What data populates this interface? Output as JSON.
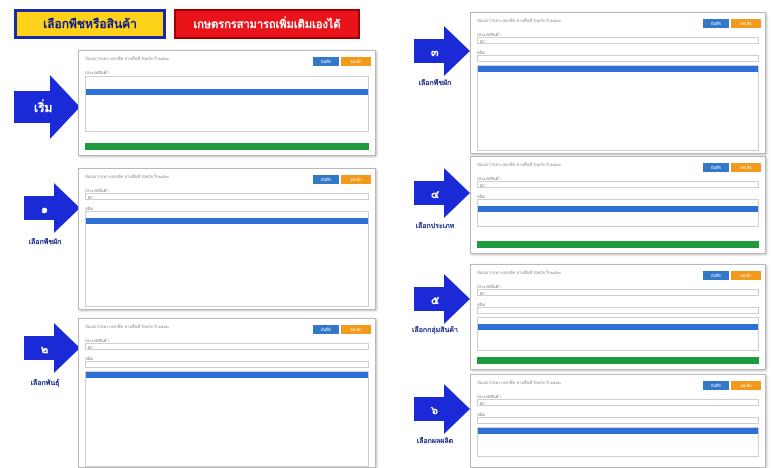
{
  "header": {
    "title_button": "เลือกพืชหรือสินค้า",
    "farmer_button": "เกษตรกรสามารถเพิ่มเติมเองได้"
  },
  "steps": [
    {
      "icon": "arrow-right-icon",
      "number": "เริ่ม",
      "caption": ""
    },
    {
      "icon": "arrow-right-icon",
      "number": "๑",
      "caption": "เลือกพืชผัก"
    },
    {
      "icon": "arrow-right-icon",
      "number": "๒",
      "caption": "เลือกพันธุ์"
    },
    {
      "icon": "arrow-right-icon",
      "number": "๓",
      "caption": "เลือกพืชผัก"
    },
    {
      "icon": "arrow-right-icon",
      "number": "๔",
      "caption": "เลือกประเภท"
    },
    {
      "icon": "arrow-right-icon",
      "number": "๕",
      "caption": "เลือกกลุ่มสินค้า"
    },
    {
      "icon": "arrow-right-icon",
      "number": "๖",
      "caption": "เลือกผลผลิต"
    }
  ],
  "panel_common": {
    "title": "ข้อมูลการเพาะปลูกพืช ตามพื้นที่ จังหวัด ปี ๒๕๖๓",
    "blue_button": "บันทึก",
    "orange_button": "ยกเลิก",
    "field_label": "ประเภทสินค้า",
    "list_label": "ชนิด",
    "select_value": "ผัก"
  },
  "colors": {
    "arrow_blue": "#1a2ad6",
    "yellow": "#ffd21a",
    "red": "#e8141a",
    "list_selected": "#2f70d8",
    "green_bar": "#1e9b3e",
    "button_blue": "#3279c8",
    "button_orange": "#f29a1c"
  }
}
